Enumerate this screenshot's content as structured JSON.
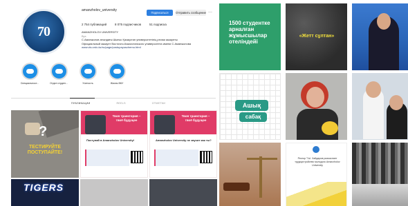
{
  "profile": {
    "username": "amanzholov_university",
    "avatar_text": "70",
    "subscribe_label": "Подписаться",
    "message_label": "Отправить сообщение",
    "more_label": "···",
    "stats": {
      "posts": "2 754 публикаций",
      "followers": "8 075 подписчиков",
      "following": "51 подписка"
    },
    "bio": {
      "name": "AMANZHOLOV UNIVERSITY",
      "category": "Вуз",
      "line1": "С.Аманжолов атындағы Шығыс Қазақстан университетінің ресми аккаунты",
      "line2": "Официальный аккаунт Восточно-Казахстанского университета имени С.Аманжолова",
      "link": "www.vku.edu.kz/ru/page/postupayuschemu.html"
    }
  },
  "highlights": [
    {
      "label": "Специальност..."
    },
    {
      "label": "Отдел студен..."
    },
    {
      "label": "Ученость"
    },
    {
      "label": "Жизнь ВКУ"
    }
  ],
  "tabs": [
    {
      "label": "ПУБЛИКАЦИИ",
      "active": true
    },
    {
      "label": "REELS",
      "active": false
    },
    {
      "label": "ОТМЕТКИ",
      "active": false
    }
  ],
  "left_posts": {
    "post1_text": "ТЕСТИРУЙТЕ ПОСТУПАЙТЕ!",
    "post2_title": "Твоя траектория – твоё будущее",
    "post2_sub": "Поступай в Amanzholov University!",
    "post3_title": "Твоя траектория – твоё будущее",
    "post3_sub": "Amanzholov University не звучит как ты?",
    "post4_text": "TIGERS"
  },
  "right_posts": {
    "post1_text": "1500 студентке арналған жұмысшылар отеліндейі",
    "post2_text": "«Жетт сұлтан»",
    "post4_text1": "Ашық",
    "post4_text2": "сабақ",
    "post8_text": "Ректор Т.Ы. Хайдаров разъясняет трудоустройство молодого Amanzholov University"
  },
  "colors": {
    "accent_blue": "#2d7fe0",
    "green_post": "#2e9f6b",
    "pink": "#e03b67"
  }
}
